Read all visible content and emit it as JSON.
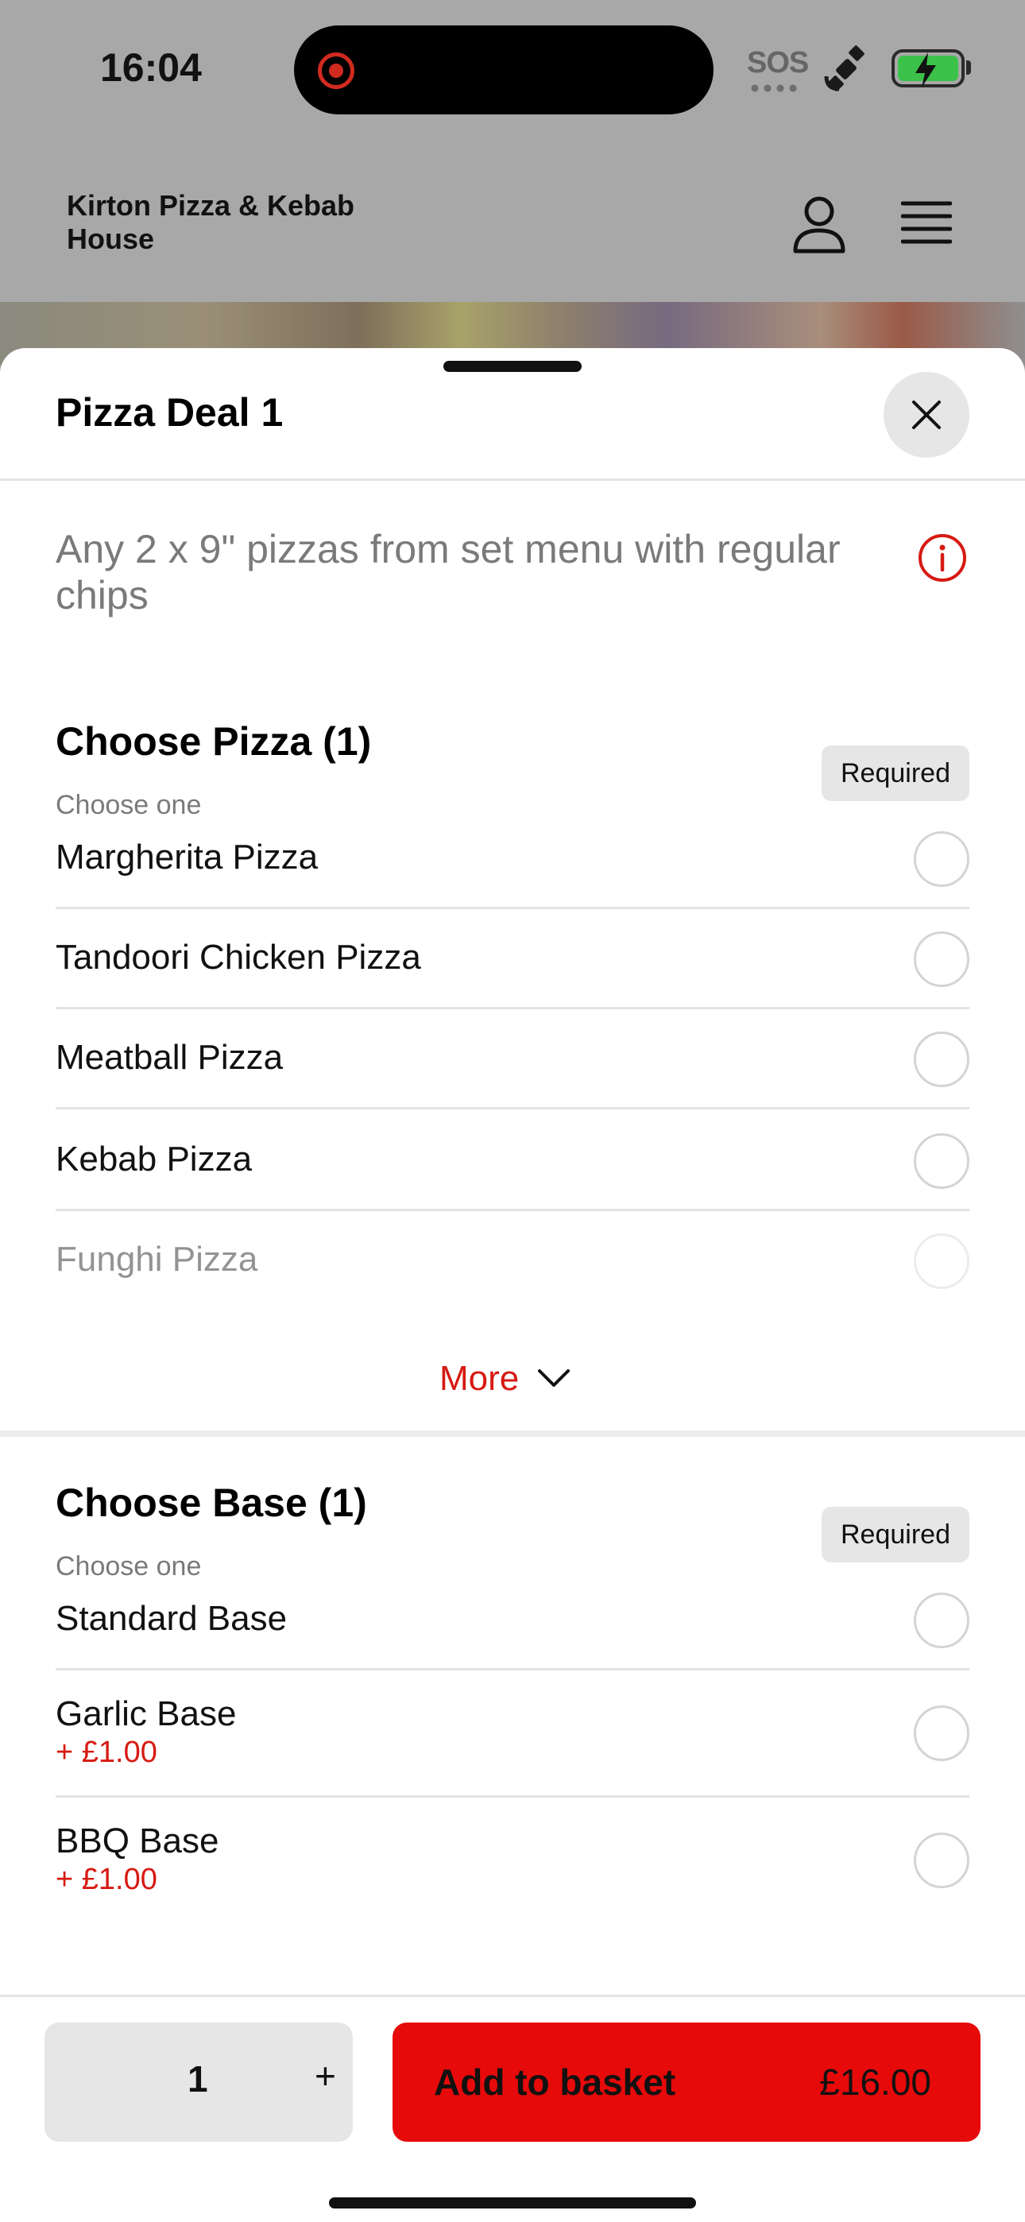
{
  "status_bar": {
    "time": "16:04",
    "sos": "SOS",
    "icons": [
      "record-icon",
      "satellite-icon",
      "battery-charging-icon"
    ],
    "battery_color": "#3cc24b"
  },
  "header": {
    "brand": "Kirton Pizza & Kebab House",
    "icons": [
      "user-icon",
      "menu-icon"
    ]
  },
  "sheet": {
    "title": "Pizza Deal 1",
    "description": "Any 2 x 9\" pizzas from set menu with regular chips",
    "close_icon": "close-icon",
    "info_icon": "info-icon"
  },
  "groups": [
    {
      "title": "Choose Pizza (1)",
      "subtitle": "Choose one",
      "badge": "Required",
      "options": [
        {
          "label": "Margherita Pizza"
        },
        {
          "label": "Tandoori Chicken Pizza"
        },
        {
          "label": "Meatball Pizza"
        },
        {
          "label": "Kebab Pizza"
        },
        {
          "label": "Funghi Pizza"
        }
      ],
      "more_label": "More"
    },
    {
      "title": "Choose Base (1)",
      "subtitle": "Choose one",
      "badge": "Required",
      "options": [
        {
          "label": "Standard Base"
        },
        {
          "label": "Garlic Base",
          "price": "+ £1.00"
        },
        {
          "label": "BBQ Base",
          "price": "+ £1.00"
        }
      ]
    }
  ],
  "footer": {
    "quantity": "1",
    "plus": "+",
    "add_label": "Add to basket",
    "price": "£16.00",
    "accent": "#e60a0a"
  }
}
